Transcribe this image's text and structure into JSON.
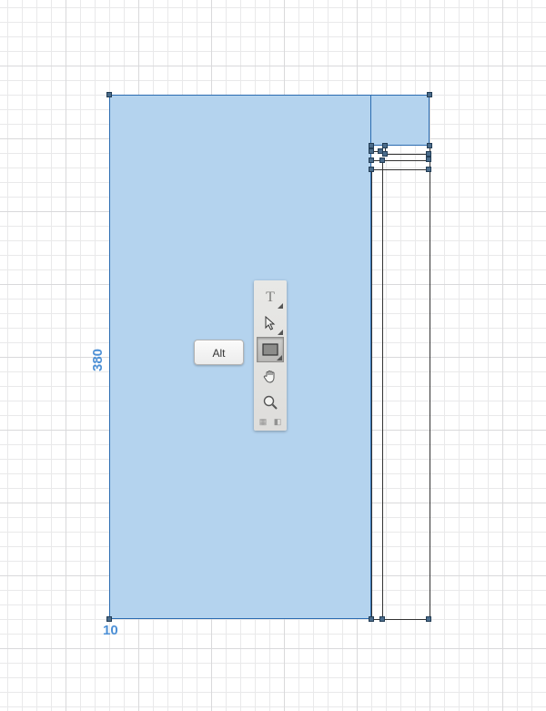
{
  "canvas": {
    "dimension_height": "380",
    "dimension_corner": "10"
  },
  "key_hint": "Alt",
  "toolbox": {
    "tools": [
      {
        "name": "type-tool",
        "selected": false
      },
      {
        "name": "selection-tool",
        "selected": false
      },
      {
        "name": "rectangle-tool",
        "selected": true
      },
      {
        "name": "hand-tool",
        "selected": false
      },
      {
        "name": "zoom-tool",
        "selected": false
      }
    ]
  }
}
